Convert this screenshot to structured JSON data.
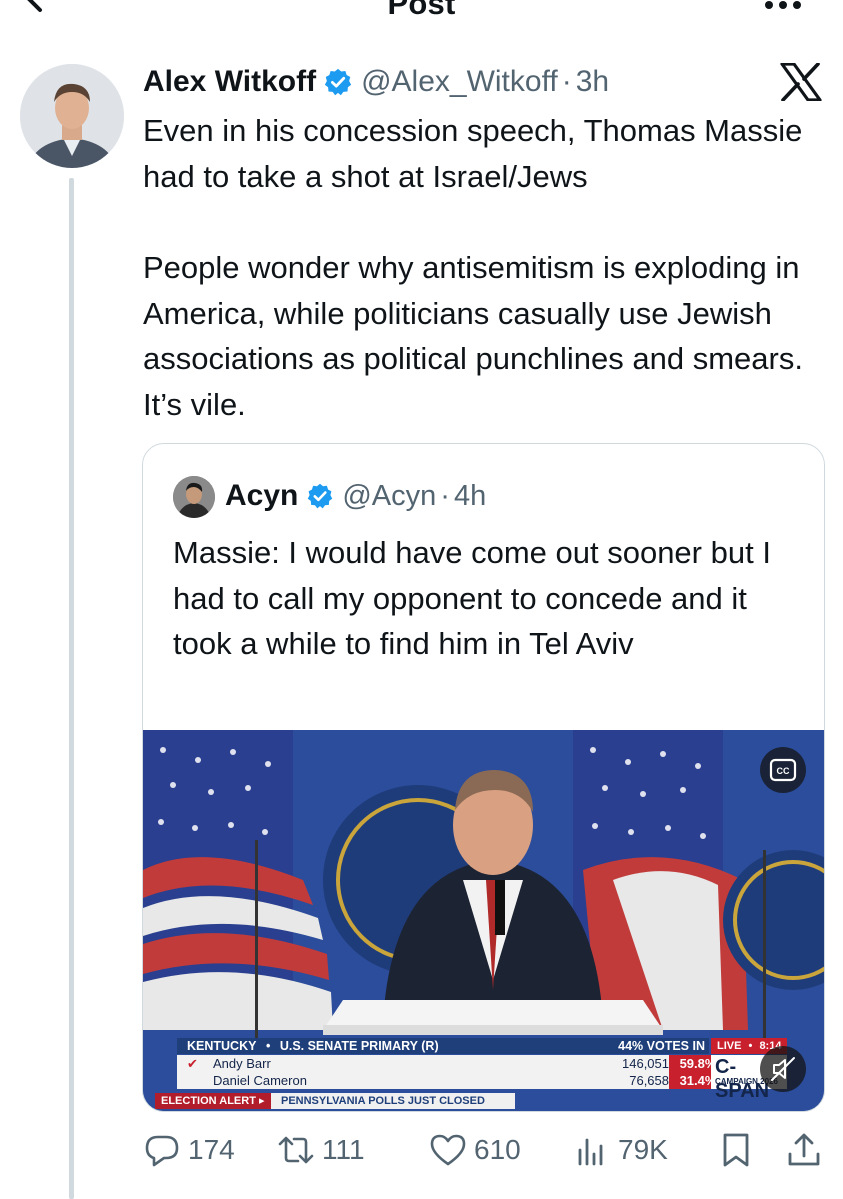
{
  "header": {
    "title": "Post",
    "back_icon": "arrow-left-icon",
    "more_icon": "more-horizontal-icon"
  },
  "tweet": {
    "author_name": "Alex Witkoff",
    "handle": "@Alex_Witkoff",
    "separator": "·",
    "time": "3h",
    "platform_icon": "x-logo-icon",
    "paragraphs": [
      "Even in his concession speech, Thomas Massie had to take a shot at Israel/Jews",
      "People wonder why antisemitism is exploding in America, while politicians casually use Jewish associations as political punchlines and smears. It’s vile."
    ]
  },
  "quote": {
    "author_name": "Acyn",
    "handle": "@Acyn",
    "separator": "·",
    "time": "4h",
    "text": "Massie: I would have come out sooner but I had to call my opponent to concede and it took a while to find him in Tel Aviv",
    "video": {
      "cc_label": "CC",
      "banner": {
        "state": "KENTUCKY",
        "bullet": "•",
        "race": "U.S. SENATE PRIMARY (R)",
        "votes_in": "44% VOTES IN",
        "live": "LIVE",
        "live_bullet": "•",
        "live_time": "8:14",
        "candidates": [
          {
            "name": "Andy Barr",
            "votes": "146,051",
            "pct": "59.8%",
            "winner_mark": "✔"
          },
          {
            "name": "Daniel Cameron",
            "votes": "76,658",
            "pct": "31.4%",
            "winner_mark": ""
          }
        ],
        "network": "C-SPAN",
        "network_sub": "CAMPAIGN 2026",
        "alert_tag": "ELECTION ALERT ▸",
        "alert_text": "PENNSYLVANIA POLLS JUST CLOSED"
      }
    }
  },
  "actions": {
    "reply_count": "174",
    "repost_count": "111",
    "like_count": "610",
    "views_count": "79K"
  },
  "colors": {
    "verified": "#1d9bf0",
    "secondary_text": "#536471",
    "border": "#cfd9de"
  }
}
